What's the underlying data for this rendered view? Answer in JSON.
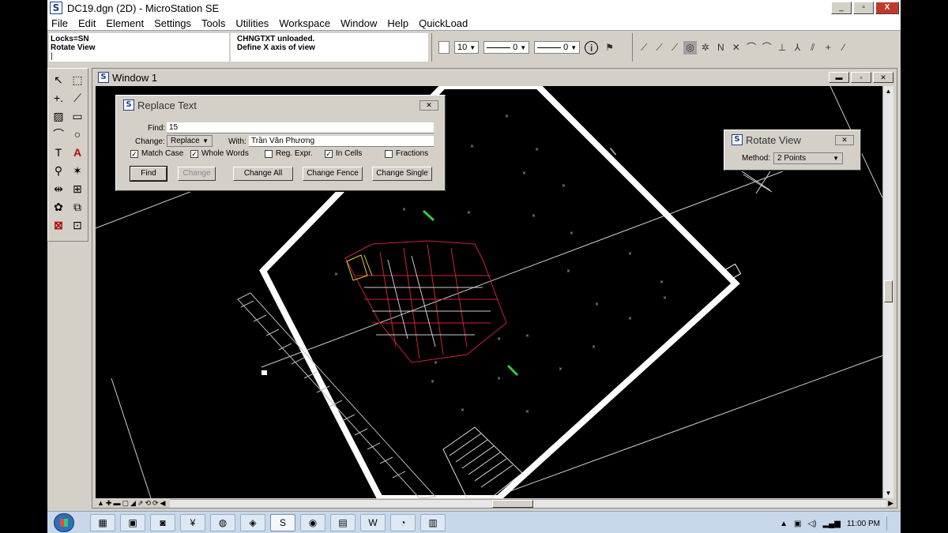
{
  "window": {
    "title": "DC19.dgn (2D) - MicroStation SE",
    "buttons": [
      "_",
      "▫",
      "X"
    ]
  },
  "menu": [
    "File",
    "Edit",
    "Element",
    "Settings",
    "Tools",
    "Utilities",
    "Workspace",
    "Window",
    "Help",
    "QuickLoad"
  ],
  "status": {
    "locks": "Locks=SN",
    "tool": "Rotate View",
    "message1": "CHNGTXT unloaded.",
    "message2": "Define X axis of view"
  },
  "attributes": {
    "weight": "10",
    "style": "0",
    "level": "0"
  },
  "view": {
    "title": "Window 1"
  },
  "replace_text": {
    "title": "Replace Text",
    "find_label": "Find:",
    "find_value": "15",
    "change_label": "Change:",
    "change_mode": "Replace",
    "with_label": "With:",
    "with_value": "Trần Văn Phương",
    "options": [
      {
        "label": "Match Case",
        "checked": true
      },
      {
        "label": "Whole Words",
        "checked": true
      },
      {
        "label": "Reg. Expr.",
        "checked": false
      },
      {
        "label": "In Cells",
        "checked": true
      },
      {
        "label": "Fractions",
        "checked": false
      }
    ],
    "buttons": {
      "find": "Find",
      "change": "Change",
      "change_all": "Change All",
      "change_fence": "Change Fence",
      "change_single": "Change Single"
    }
  },
  "rotate_view": {
    "title": "Rotate View",
    "method_label": "Method:",
    "method_value": "2 Points"
  },
  "taskbar": {
    "clock": "11:00 PM"
  }
}
